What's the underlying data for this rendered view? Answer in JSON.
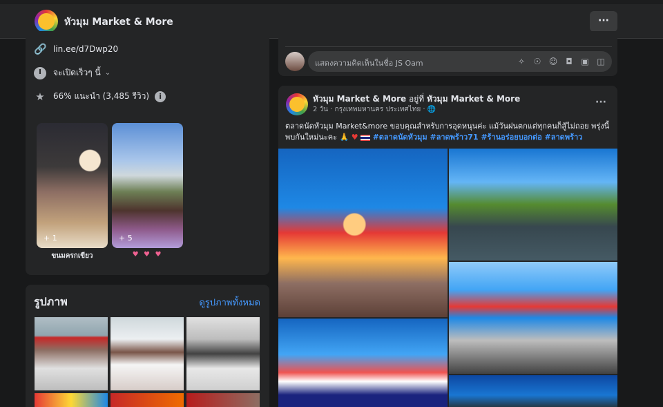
{
  "header": {
    "page_name": "หัวมุม Market & More",
    "more_label": "···"
  },
  "intro": {
    "link": "lin.ee/d7Dwp20",
    "hours": "จะเปิดเร็วๆ นี้",
    "rating": "66% แนะนำ (3,485 รีวิว)",
    "info_icon": "i"
  },
  "featured": [
    {
      "count": "+ 1",
      "label": "ขนมครกเขียว"
    },
    {
      "count": "+ 5",
      "label": "♥ ♥ ♥"
    }
  ],
  "photos": {
    "title": "รูปภาพ",
    "see_all": "ดูรูปภาพทั้งหมด"
  },
  "comment": {
    "placeholder": "แสดงความคิดเห็นในชื่อ JS Oam"
  },
  "post": {
    "author": "หัวมุม Market & More",
    "at_word": "อยู่ที่",
    "location_page": "หัวมุม Market & More",
    "meta": "2 วัน · กรุงเทพมหานคร ประเทศไทย · ",
    "text": "ตลาดนัดหัวมุม Market&more ขอบคุณสำหรับการอุดหนุนค่ะ แม้วันฝนตกแต่ทุกคนก็สู้ไม่ถอย พรุ่งนี้พบกันใหม่นะคะ 🙏",
    "hashtags": "#ตลาดนัดหัวมุม #ลาดพร้าว71 #ร้านอร่อยบอกต่อ #ลาดพร้าว",
    "more_label": "···"
  },
  "colors": {
    "background": "#18191a",
    "card": "#242526",
    "link_blue": "#4599ff"
  }
}
